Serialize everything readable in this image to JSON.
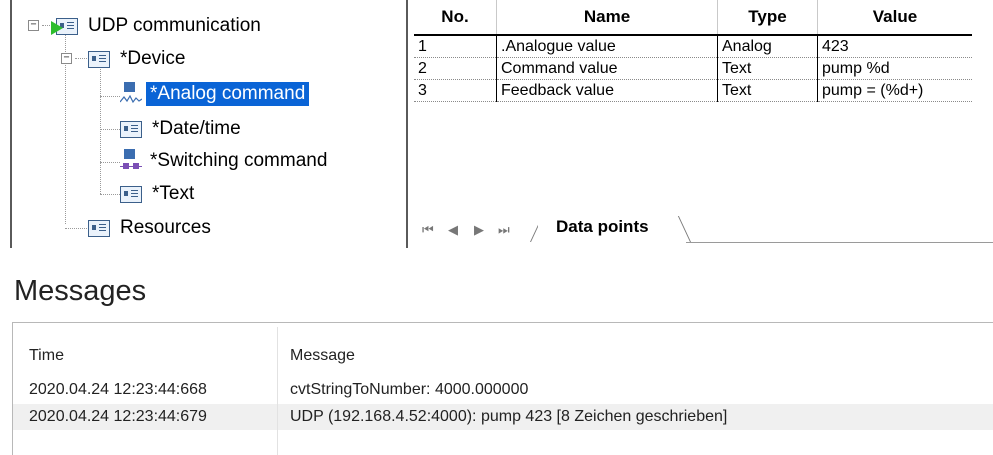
{
  "tree": {
    "root_label": "UDP communication",
    "device_label": "*Device",
    "children": [
      {
        "label": "*Analog command",
        "icon": "analog-signal-icon",
        "selected": true
      },
      {
        "label": "*Date/time",
        "icon": "card-icon"
      },
      {
        "label": "*Switching command",
        "icon": "switch-signal-icon"
      },
      {
        "label": "*Text",
        "icon": "card-icon"
      }
    ],
    "resources_label": "Resources",
    "expander_minus": "−"
  },
  "grid": {
    "headers": {
      "no": "No.",
      "name": "Name",
      "type": "Type",
      "value": "Value"
    },
    "rows": [
      {
        "no": "1",
        "name": ".Analogue value",
        "type": "Analog",
        "value": "423"
      },
      {
        "no": "2",
        "name": "Command value",
        "type": "Text",
        "value": "pump %d"
      },
      {
        "no": "3",
        "name": "Feedback value",
        "type": "Text",
        "value": "pump = (%d+)"
      }
    ],
    "nav": {
      "first": "⏮",
      "prev": "◀",
      "next": "▶",
      "last": "⏭"
    },
    "sheet_tab": "Data points"
  },
  "messages": {
    "title": "Messages",
    "columns": {
      "time": "Time",
      "message": "Message"
    },
    "rows": [
      {
        "time": "2020.04.24 12:23:44:668",
        "message": "cvtStringToNumber: 4000.000000"
      },
      {
        "time": "2020.04.24 12:23:44:679",
        "message": "UDP (192.168.4.52:4000): pump 423 [8 Zeichen geschrieben]"
      }
    ]
  },
  "colors": {
    "selection": "#0a64d6",
    "play": "#2dbd2d",
    "chip": "#3b6db0",
    "switch": "#7b4fb5"
  }
}
